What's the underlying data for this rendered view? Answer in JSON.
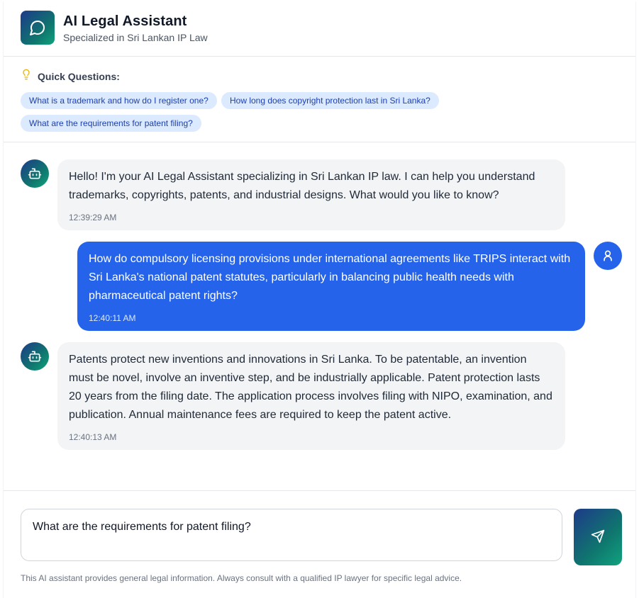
{
  "header": {
    "title": "AI Legal Assistant",
    "subtitle": "Specialized in Sri Lankan IP Law",
    "icon": "chat-bubble-icon"
  },
  "quick_questions": {
    "title": "Quick Questions:",
    "icon": "lightbulb-icon",
    "items": [
      "What is a trademark and how do I register one?",
      "How long does copyright protection last in Sri Lanka?",
      "What are the requirements for patent filing?"
    ]
  },
  "messages": [
    {
      "role": "bot",
      "text": "Hello! I'm your AI Legal Assistant specializing in Sri Lankan IP law. I can help you understand trademarks, copyrights, patents, and industrial designs. What would you like to know?",
      "time": "12:39:29 AM"
    },
    {
      "role": "user",
      "text": "How do compulsory licensing provisions under international agreements like TRIPS interact with Sri Lanka's national patent statutes, particularly in balancing public health needs with pharmaceutical patent rights?",
      "time": "12:40:11 AM"
    },
    {
      "role": "bot",
      "text": "Patents protect new inventions and innovations in Sri Lanka. To be patentable, an invention must be novel, involve an inventive step, and be industrially applicable. Patent protection lasts 20 years from the filing date. The application process involves filing with NIPO, examination, and publication. Annual maintenance fees are required to keep the patent active.",
      "time": "12:40:13 AM"
    }
  ],
  "composer": {
    "value": "What are the requirements for patent filing?",
    "send_icon": "send-icon",
    "disclaimer": "This AI assistant provides general legal information. Always consult with a qualified IP lawyer for specific legal advice."
  },
  "colors": {
    "accent_blue": "#2563eb",
    "chip_bg": "#dbeafe",
    "gradient_start": "#1e3a8a",
    "gradient_end": "#10a37f"
  }
}
